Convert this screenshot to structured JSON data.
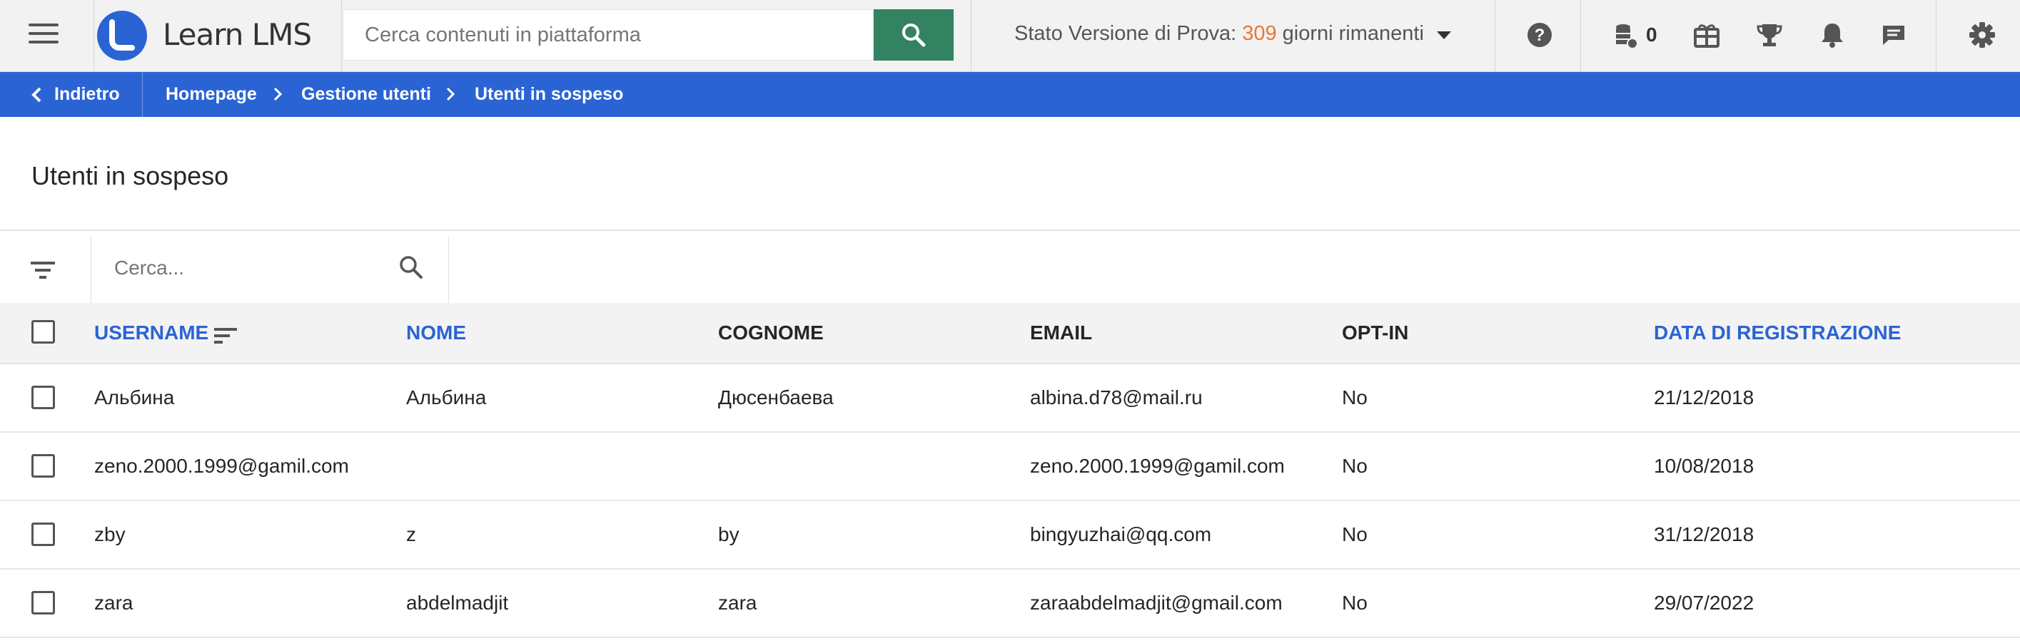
{
  "header": {
    "brand": "Learn LMS",
    "search_placeholder": "Cerca contenuti in piattaforma",
    "trial_prefix": "Stato Versione di Prova:",
    "trial_days": "309",
    "trial_suffix": "giorni rimanenti",
    "coins": "0",
    "icons": [
      "menu-icon",
      "search-icon",
      "help-icon",
      "coins-icon",
      "gift-icon",
      "trophy-icon",
      "bell-icon",
      "chat-icon",
      "gear-icon"
    ]
  },
  "breadcrumb": {
    "back_label": "Indietro",
    "items": [
      "Homepage",
      "Gestione utenti",
      "Utenti in sospeso"
    ]
  },
  "page": {
    "title": "Utenti in sospeso",
    "search_placeholder": "Cerca..."
  },
  "table": {
    "columns": [
      "USERNAME",
      "NOME",
      "COGNOME",
      "EMAIL",
      "OPT-IN",
      "DATA DI REGISTRAZIONE"
    ],
    "rows": [
      {
        "username": "Альбина",
        "nome": "Альбина",
        "cognome": "Дюсенбаева",
        "email": "albina.d78@mail.ru",
        "optin": "No",
        "data": "21/12/2018"
      },
      {
        "username": "zeno.2000.1999@gamil.com",
        "nome": "",
        "cognome": "",
        "email": "zeno.2000.1999@gamil.com",
        "optin": "No",
        "data": "10/08/2018"
      },
      {
        "username": "zby",
        "nome": "z",
        "cognome": "by",
        "email": "bingyuzhai@qq.com",
        "optin": "No",
        "data": "31/12/2018"
      },
      {
        "username": "zara",
        "nome": "abdelmadjit",
        "cognome": "zara",
        "email": "zaraabdelmadjit@gmail.com",
        "optin": "No",
        "data": "29/07/2022"
      }
    ]
  },
  "colors": {
    "brand_blue": "#2a64d4",
    "search_green": "#338363",
    "trial_orange": "#e8773a"
  }
}
